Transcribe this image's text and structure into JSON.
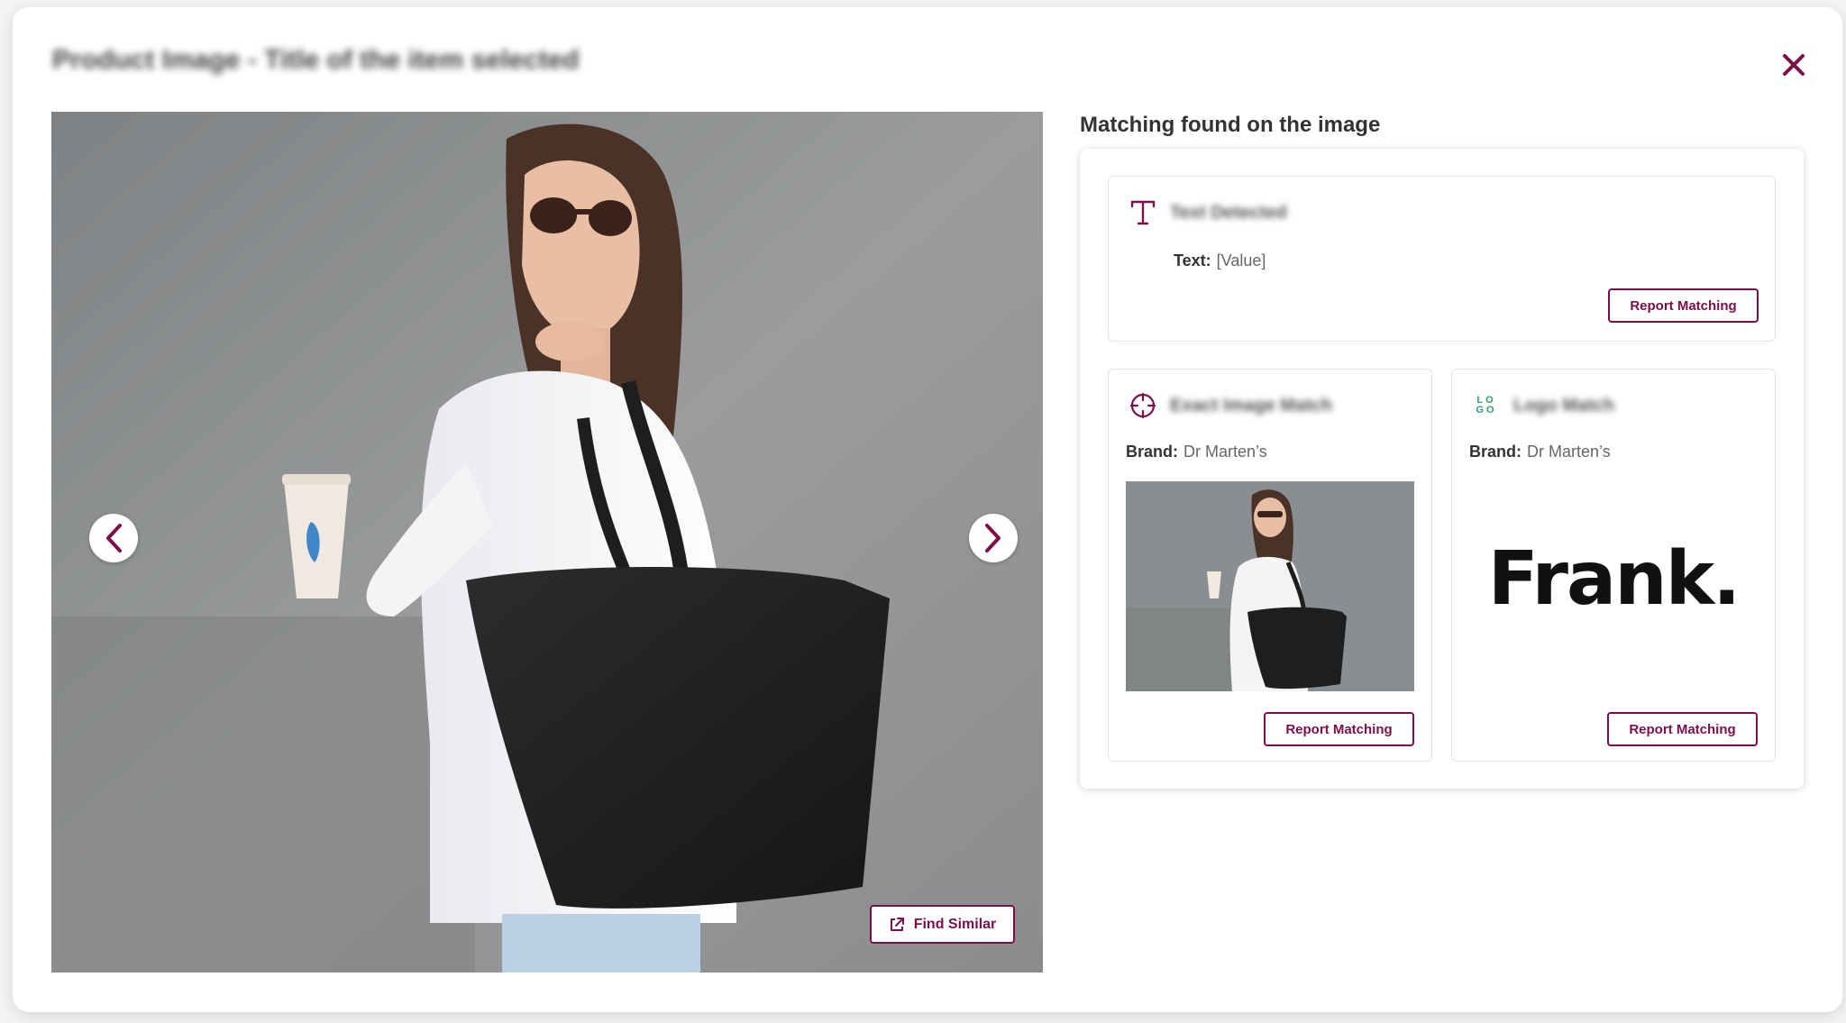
{
  "modal": {
    "title": "Product Image - Title of the item selected",
    "close_icon": "close-icon"
  },
  "viewer": {
    "prev_icon": "chevron-left-icon",
    "next_icon": "chevron-right-icon",
    "find_similar_label": "Find Similar",
    "find_similar_icon": "external-link-icon"
  },
  "matching": {
    "heading": "Matching found on the image",
    "text_card": {
      "icon": "text-icon",
      "title": "Text Detected",
      "field_label": "Text:",
      "field_value": "[Value]",
      "report_label": "Report Matching"
    },
    "exact_card": {
      "icon": "crosshair-icon",
      "title": "Exact Image Match",
      "field_label": "Brand:",
      "field_value": "Dr Marten’s",
      "report_label": "Report Matching"
    },
    "logo_card": {
      "icon": "logo-icon",
      "icon_text_top": "LO",
      "icon_text_bottom": "GO",
      "title": "Logo Match",
      "field_label": "Brand:",
      "field_value": "Dr Marten’s",
      "logo_text": "Frank.",
      "report_label": "Report Matching"
    }
  },
  "colors": {
    "accent": "#7a0f4a",
    "logo_icon": "#2f9e6e"
  }
}
